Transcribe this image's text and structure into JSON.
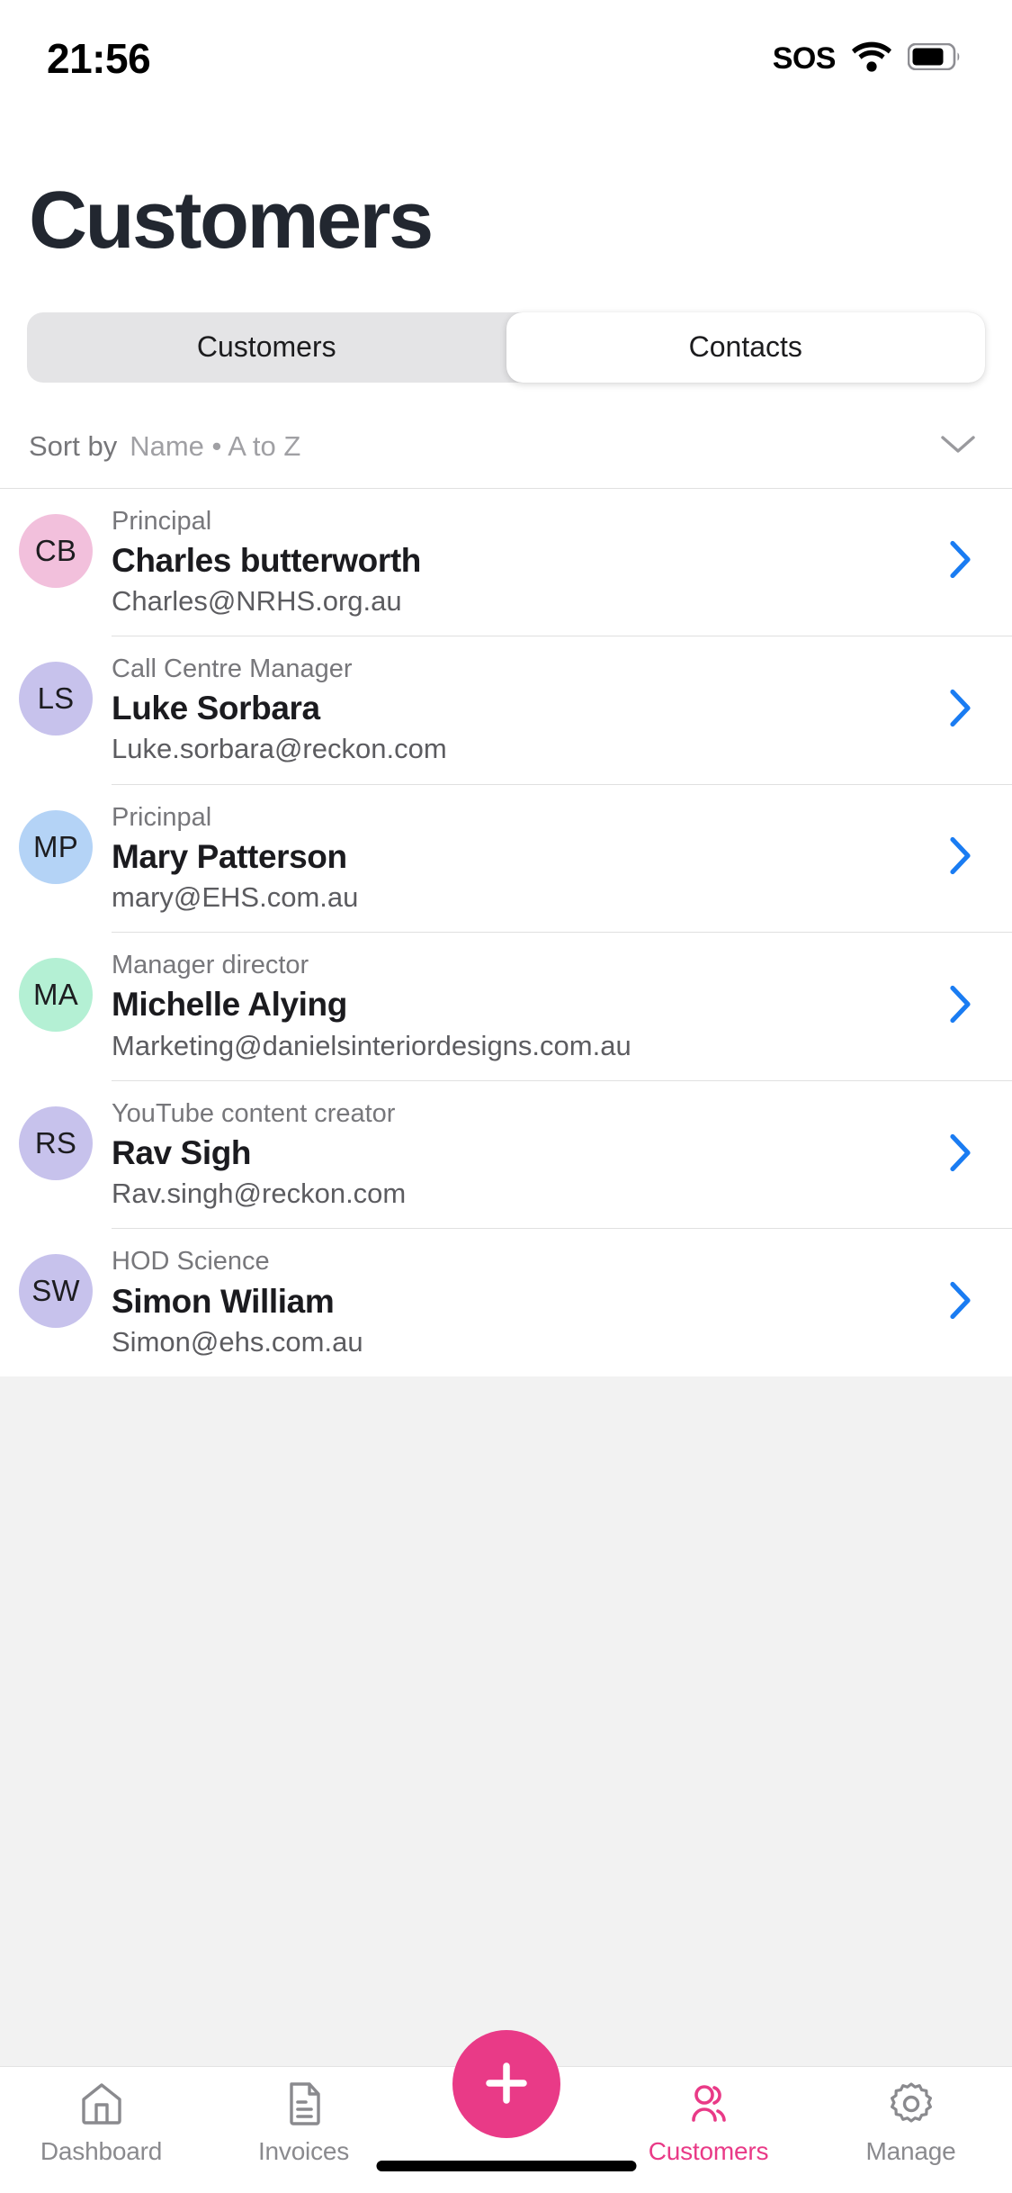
{
  "status_bar": {
    "time": "21:56",
    "sos": "SOS",
    "wifi_icon": "wifi-icon",
    "battery_icon": "battery-icon"
  },
  "header": {
    "title": "Customers"
  },
  "segmented_control": {
    "tabs": [
      {
        "label": "Customers",
        "active": false
      },
      {
        "label": "Contacts",
        "active": true
      }
    ]
  },
  "sort": {
    "label": "Sort by",
    "value": "Name • A to Z",
    "chevron_icon": "chevron-down-icon"
  },
  "contacts": [
    {
      "initials": "CB",
      "avatar_color": "#f2c0dc",
      "role": "Principal",
      "name": "Charles butterworth",
      "email": "Charles@NRHS.org.au"
    },
    {
      "initials": "LS",
      "avatar_color": "#c7c2ec",
      "role": "Call Centre Manager",
      "name": "Luke Sorbara",
      "email": "Luke.sorbara@reckon.com"
    },
    {
      "initials": "MP",
      "avatar_color": "#b4d3f6",
      "role": "Pricinpal",
      "name": "Mary Patterson",
      "email": "mary@EHS.com.au"
    },
    {
      "initials": "MA",
      "avatar_color": "#b4f0d4",
      "role": "Manager director",
      "name": "Michelle Alying",
      "email": "Marketing@danielsinteriordesigns.com.au"
    },
    {
      "initials": "RS",
      "avatar_color": "#c7c2ec",
      "role": "YouTube content creator",
      "name": "Rav Sigh",
      "email": "Rav.singh@reckon.com"
    },
    {
      "initials": "SW",
      "avatar_color": "#c7c2ec",
      "role": "HOD Science",
      "name": "Simon William",
      "email": "Simon@ehs.com.au"
    }
  ],
  "bottom_nav": {
    "items": [
      {
        "label": "Dashboard",
        "icon": "home-icon",
        "active": false
      },
      {
        "label": "Invoices",
        "icon": "document-icon",
        "active": false
      },
      {
        "label": "Customers",
        "icon": "people-icon",
        "active": true
      },
      {
        "label": "Manage",
        "icon": "gear-icon",
        "active": false
      }
    ],
    "fab_icon": "plus-icon"
  },
  "colors": {
    "accent_pink": "#e93a87",
    "chevron_blue": "#1a7cf2",
    "title_dark": "#222730",
    "muted_gray": "#8a8a8e",
    "filler_gray": "#f2f2f2"
  }
}
